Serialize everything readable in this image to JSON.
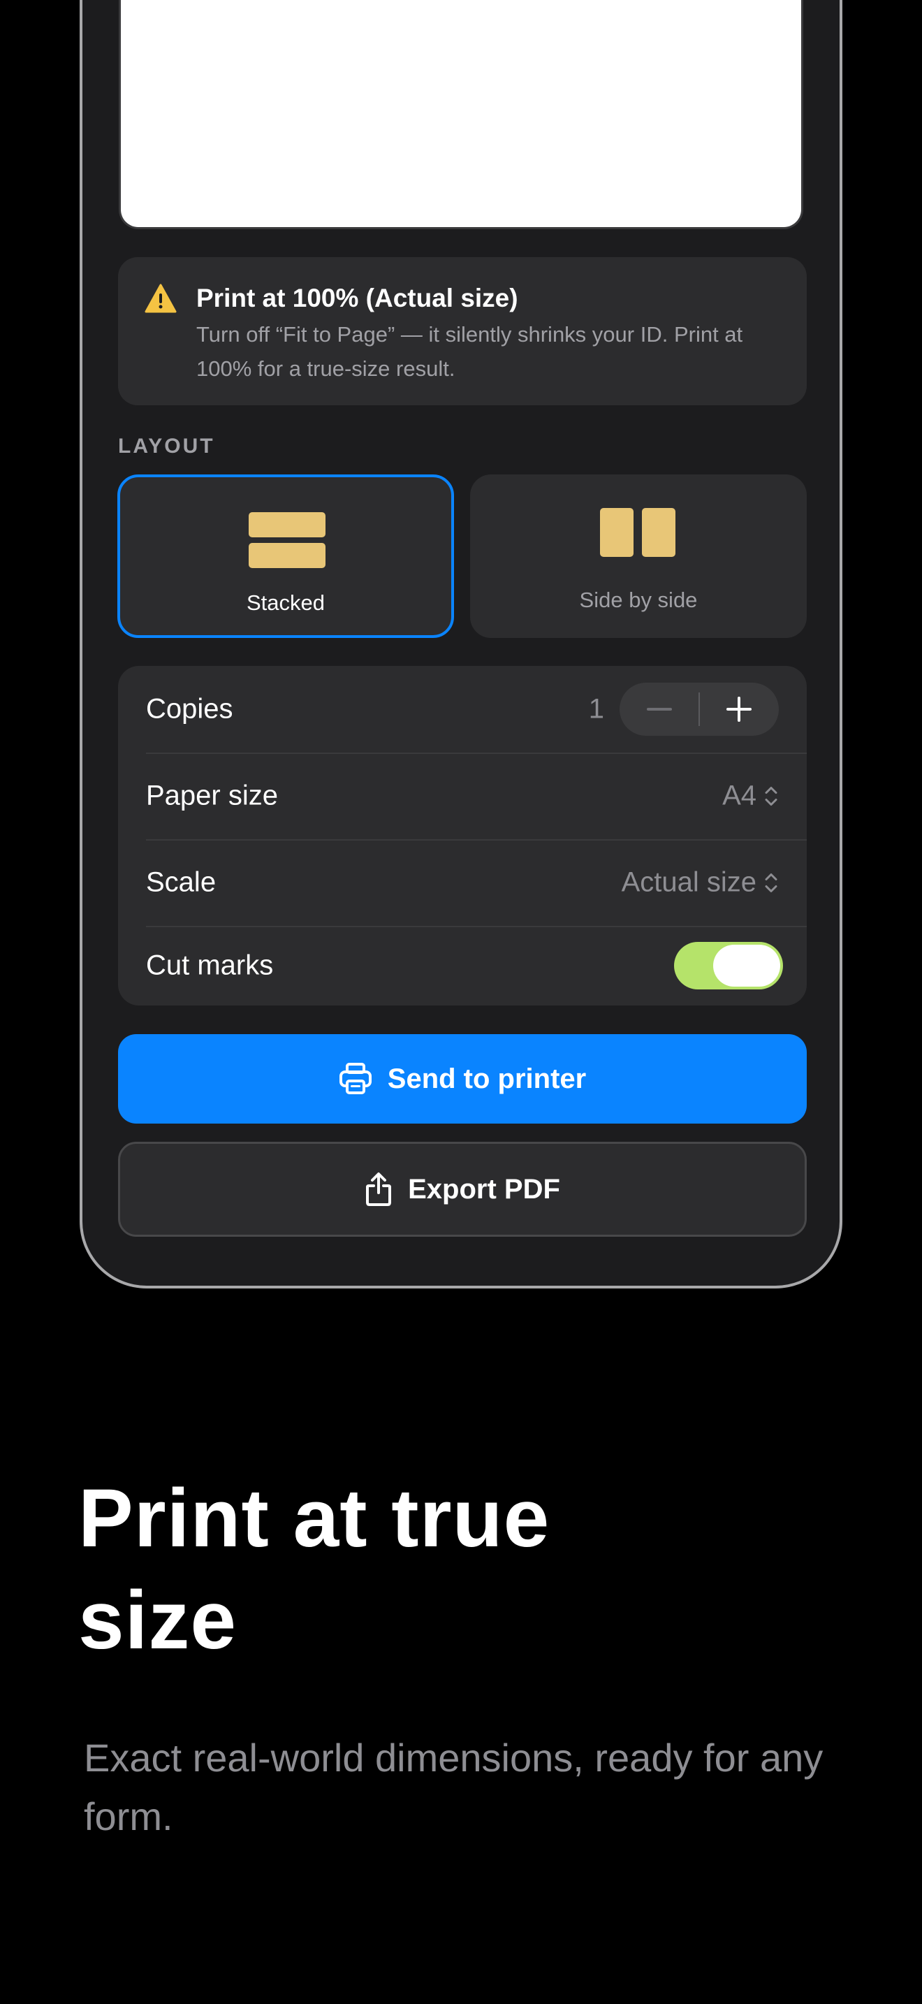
{
  "notice": {
    "title": "Print at 100% (Actual size)",
    "body": "Turn off “Fit to Page” — it silently shrinks your ID. Print at 100% for a true-size result.",
    "icon": "warning-icon",
    "icon_color": "#f5c343"
  },
  "layout": {
    "section_label": "LAYOUT",
    "options": [
      {
        "label": "Stacked",
        "icon": "stacked-layout-icon",
        "selected": true
      },
      {
        "label": "Side by side",
        "icon": "side-by-side-layout-icon",
        "selected": false
      }
    ]
  },
  "settings": {
    "copies": {
      "label": "Copies",
      "value": "1"
    },
    "paper_size": {
      "label": "Paper size",
      "value": "A4"
    },
    "scale": {
      "label": "Scale",
      "value": "Actual size"
    },
    "cut_marks": {
      "label": "Cut marks",
      "enabled": true
    }
  },
  "actions": {
    "send_label": "Send to printer",
    "export_label": "Export PDF"
  },
  "marketing": {
    "headline_line1": "Print at true",
    "headline_line2": "size",
    "subline": "Exact real-world dimensions, ready for any form."
  },
  "colors": {
    "accent": "#0a84ff",
    "toggle_on": "#b5e36a",
    "layout_glyph": "#e8c677"
  }
}
